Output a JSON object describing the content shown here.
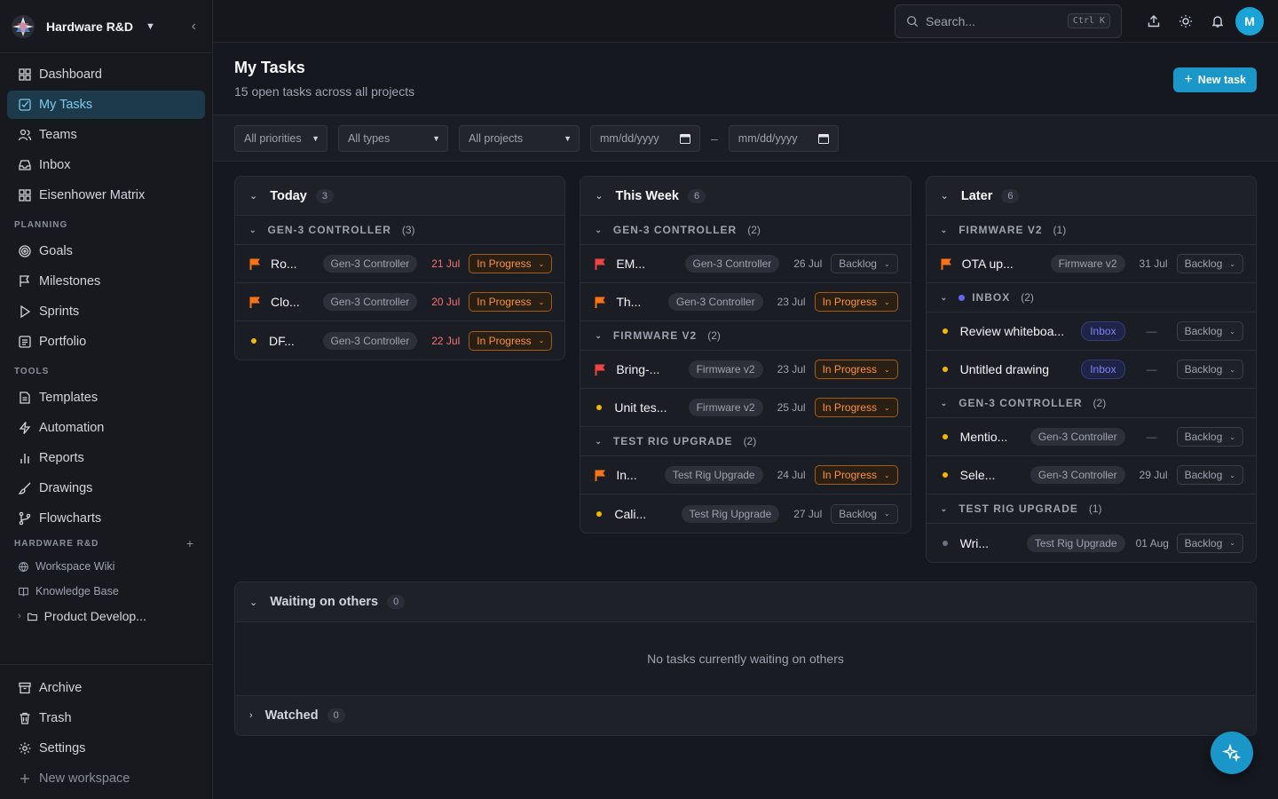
{
  "workspace": {
    "name": "Hardware R&D"
  },
  "nav": {
    "main": [
      {
        "label": "Dashboard",
        "icon": "grid-icon"
      },
      {
        "label": "My Tasks",
        "icon": "check-square-icon"
      },
      {
        "label": "Teams",
        "icon": "users-icon"
      },
      {
        "label": "Inbox",
        "icon": "inbox-icon"
      },
      {
        "label": "Eisenhower Matrix",
        "icon": "grid-icon"
      }
    ],
    "planning_label": "PLANNING",
    "planning": [
      {
        "label": "Goals"
      },
      {
        "label": "Milestones"
      },
      {
        "label": "Sprints"
      },
      {
        "label": "Portfolio"
      }
    ],
    "tools_label": "TOOLS",
    "tools": [
      {
        "label": "Templates"
      },
      {
        "label": "Automation"
      },
      {
        "label": "Reports"
      },
      {
        "label": "Drawings"
      },
      {
        "label": "Flowcharts"
      }
    ],
    "space_label": "HARDWARE R&D",
    "space": [
      {
        "label": "Workspace Wiki"
      },
      {
        "label": "Knowledge Base"
      },
      {
        "label": "Product Develop..."
      }
    ],
    "bottom": [
      {
        "label": "Archive"
      },
      {
        "label": "Trash"
      },
      {
        "label": "Settings"
      },
      {
        "label": "New workspace"
      }
    ]
  },
  "topbar": {
    "search_placeholder": "Search...",
    "shortcut": "Ctrl K",
    "avatar": "M"
  },
  "page": {
    "title": "My Tasks",
    "subtitle": "15 open tasks across all projects",
    "new_task": "New task"
  },
  "filters": {
    "priority": "All priorities",
    "type": "All types",
    "project": "All projects",
    "date_from": "mm/dd/yyyy",
    "date_sep": "–",
    "date_to": "mm/dd/yyyy"
  },
  "columns": [
    {
      "title": "Today",
      "count": "3",
      "groups": [
        {
          "name": "GEN-3 CONTROLLER",
          "count": "(3)",
          "tasks": [
            {
              "name": "Ro...",
              "marker": "flag-orange",
              "project": "Gen-3 Controller",
              "due": "21 Jul",
              "due_style": "over",
              "status": "In Progress",
              "status_style": "prog"
            },
            {
              "name": "Clo...",
              "marker": "flag-orange",
              "project": "Gen-3 Controller",
              "due": "20 Jul",
              "due_style": "over",
              "status": "In Progress",
              "status_style": "prog"
            },
            {
              "name": "DF...",
              "marker": "dot-yellow",
              "project": "Gen-3 Controller",
              "due": "22 Jul",
              "due_style": "over",
              "status": "In Progress",
              "status_style": "prog"
            }
          ]
        }
      ]
    },
    {
      "title": "This Week",
      "count": "6",
      "groups": [
        {
          "name": "GEN-3 CONTROLLER",
          "count": "(2)",
          "tasks": [
            {
              "name": "EM...",
              "marker": "flag-red",
              "project": "Gen-3 Controller",
              "due": "26 Jul",
              "due_style": "",
              "status": "Backlog",
              "status_style": ""
            },
            {
              "name": "Th...",
              "marker": "flag-orange",
              "project": "Gen-3 Controller",
              "due": "23 Jul",
              "due_style": "",
              "status": "In Progress",
              "status_style": "prog"
            }
          ]
        },
        {
          "name": "FIRMWARE V2",
          "count": "(2)",
          "tasks": [
            {
              "name": "Bring-...",
              "marker": "flag-red",
              "project": "Firmware v2",
              "due": "23 Jul",
              "due_style": "",
              "status": "In Progress",
              "status_style": "prog"
            },
            {
              "name": "Unit tes...",
              "marker": "dot-yellow",
              "project": "Firmware v2",
              "due": "25 Jul",
              "due_style": "",
              "status": "In Progress",
              "status_style": "prog"
            }
          ]
        },
        {
          "name": "TEST RIG UPGRADE",
          "count": "(2)",
          "tasks": [
            {
              "name": "In...",
              "marker": "flag-orange",
              "project": "Test Rig Upgrade",
              "due": "24 Jul",
              "due_style": "",
              "status": "In Progress",
              "status_style": "prog"
            },
            {
              "name": "Cali...",
              "marker": "dot-yellow",
              "project": "Test Rig Upgrade",
              "due": "27 Jul",
              "due_style": "",
              "status": "Backlog",
              "status_style": ""
            }
          ]
        }
      ]
    },
    {
      "title": "Later",
      "count": "6",
      "groups": [
        {
          "name": "FIRMWARE V2",
          "count": "(1)",
          "tasks": [
            {
              "name": "OTA up...",
              "marker": "flag-orange",
              "project": "Firmware v2",
              "due": "31 Jul",
              "due_style": "",
              "status": "Backlog",
              "status_style": ""
            }
          ]
        },
        {
          "name": "INBOX",
          "count": "(2)",
          "dot": true,
          "tasks": [
            {
              "name": "Review whiteboa...",
              "marker": "dot-yellow",
              "project": "Inbox",
              "project_style": "inbox",
              "due": "—",
              "due_style": "none",
              "status": "Backlog",
              "status_style": ""
            },
            {
              "name": "Untitled drawing",
              "marker": "dot-yellow",
              "project": "Inbox",
              "project_style": "inbox",
              "due": "—",
              "due_style": "none",
              "status": "Backlog",
              "status_style": ""
            }
          ]
        },
        {
          "name": "GEN-3 CONTROLLER",
          "count": "(2)",
          "tasks": [
            {
              "name": "Mentio...",
              "marker": "dot-yellow",
              "project": "Gen-3 Controller",
              "due": "—",
              "due_style": "none",
              "status": "Backlog",
              "status_style": ""
            },
            {
              "name": "Sele...",
              "marker": "dot-yellow",
              "project": "Gen-3 Controller",
              "due": "29 Jul",
              "due_style": "",
              "status": "Backlog",
              "status_style": ""
            }
          ]
        },
        {
          "name": "TEST RIG UPGRADE",
          "count": "(1)",
          "tasks": [
            {
              "name": "Wri...",
              "marker": "dot-gray",
              "project": "Test Rig Upgrade",
              "due": "01 Aug",
              "due_style": "",
              "status": "Backlog",
              "status_style": ""
            }
          ]
        }
      ]
    }
  ],
  "waiting": {
    "title": "Waiting on others",
    "count": "0",
    "empty": "No tasks currently waiting on others"
  },
  "watched": {
    "title": "Watched",
    "count": "0"
  },
  "colors": {
    "accent": "#1a96c8",
    "flag_orange": "#f97316",
    "flag_red": "#ef4444",
    "dot_yellow": "#f5b800",
    "dot_gray": "#6b7280",
    "inbox": "#6366f1"
  }
}
